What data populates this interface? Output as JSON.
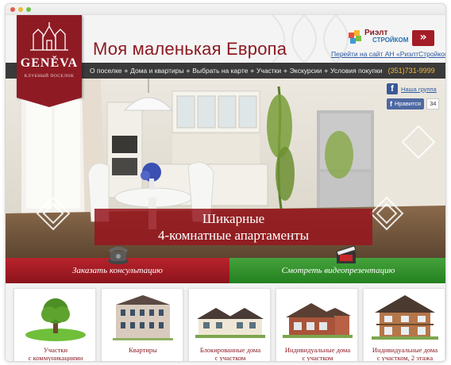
{
  "site": {
    "title": "Моя маленькая Европа",
    "logo_name": "GENĚVA",
    "logo_tagline": "КЛУБНЫЙ ПОСЕЛОК"
  },
  "partner": {
    "logo_name": "Риэлт",
    "logo_sub": "СТРОЙКОМ",
    "go_label": "»",
    "link_text": "Перейти на сайт АН «РиэлтСтройком»"
  },
  "nav": {
    "items": [
      {
        "label": "О поселке"
      },
      {
        "label": "Дома и квартиры"
      },
      {
        "label": "Выбрать на карте"
      },
      {
        "label": "Участки"
      },
      {
        "label": "Экскурсии"
      },
      {
        "label": "Условия покупки"
      }
    ],
    "phone": "(351)731-9999"
  },
  "social": {
    "fb_icon": "f",
    "group_link": "Наша группа",
    "like_label": "Нравится",
    "like_count": "34"
  },
  "hero": {
    "line1": "Шикарные",
    "line2": "4-комнатные апартаменты"
  },
  "cta": {
    "consult_label": "Заказать консультацию",
    "video_label": "Смотреть видеопрезентацию"
  },
  "cards": [
    {
      "line1": "Участки",
      "line2": "с коммуникациями",
      "icon": "tree-on-lawn-icon"
    },
    {
      "line1": "Квартиры",
      "line2": "",
      "icon": "apartment-building-icon"
    },
    {
      "line1": "Блокированные дома",
      "line2": "с участком",
      "icon": "townhouse-icon"
    },
    {
      "line1": "Индивидуальные дома",
      "line2": "с участком",
      "icon": "brick-house-icon"
    },
    {
      "line1": "Индивидуальные дома",
      "line2": "с участком, 2 этажа",
      "icon": "two-storey-house-icon"
    }
  ],
  "colors": {
    "brand": "#8e1b24",
    "nav_bg": "#3a3a3a",
    "phone": "#f2b93b",
    "cta_red": "#b8232c",
    "cta_green": "#45a23c",
    "facebook": "#3b5998"
  }
}
